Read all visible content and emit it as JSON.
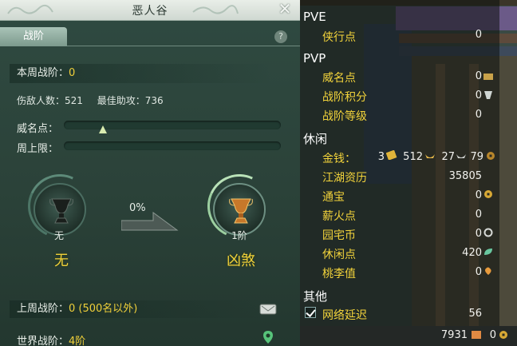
{
  "panel": {
    "title": "恶人谷",
    "close": "✕",
    "tab": "战阶",
    "help": "?"
  },
  "weekly": {
    "label": "本周战阶：",
    "value": "0"
  },
  "stats": {
    "kills": "伤敌人数：521",
    "assists": "最佳助攻：736"
  },
  "prestige": {
    "label": "威名点：",
    "weekcap_label": "周上限：",
    "progress": 0.18
  },
  "rank": {
    "current_sub": "无",
    "current_name": "无",
    "progress_pct": "0%",
    "next_sub": "1阶",
    "next_name": "凶煞"
  },
  "last_week": {
    "label": "上周战阶：",
    "value": "0 (500名以外)"
  },
  "world": {
    "label": "世界战阶：",
    "value": "4阶"
  },
  "right": {
    "pve": {
      "section": "PVE",
      "xiaxing_label": "侠行点",
      "xiaxing_value": "0"
    },
    "pvp": {
      "section": "PVP",
      "weiming_label": "威名点",
      "weiming_value": "0",
      "jifen_label": "战阶积分",
      "jifen_value": "0",
      "dengji_label": "战阶等级",
      "dengji_value": "0"
    },
    "leisure": {
      "section": "休闲",
      "money_label": "金钱：",
      "gold": "3",
      "silver": "512",
      "copper": "27",
      "extra": "79",
      "jianghu_label": "江湖资历",
      "jianghu_value": "35805",
      "tongbao_label": "通宝",
      "tongbao_value": "0",
      "xinhuo_label": "薪火点",
      "xinhuo_value": "0",
      "yuanzhai_label": "园宅币",
      "yuanzhai_value": "0",
      "xiuxian_label": "休闲点",
      "xiuxian_value": "420",
      "taoli_label": "桃李值",
      "taoli_value": "0"
    },
    "other": {
      "section": "其他",
      "ping_label": "网络延迟",
      "ping_value": "56"
    },
    "bottom": {
      "currency_a": "7931",
      "currency_b": "0"
    }
  },
  "colors": {
    "accent_yellow": "#f0d03a",
    "panel_teal": "#2f4a41",
    "header": "#e9eee8"
  }
}
